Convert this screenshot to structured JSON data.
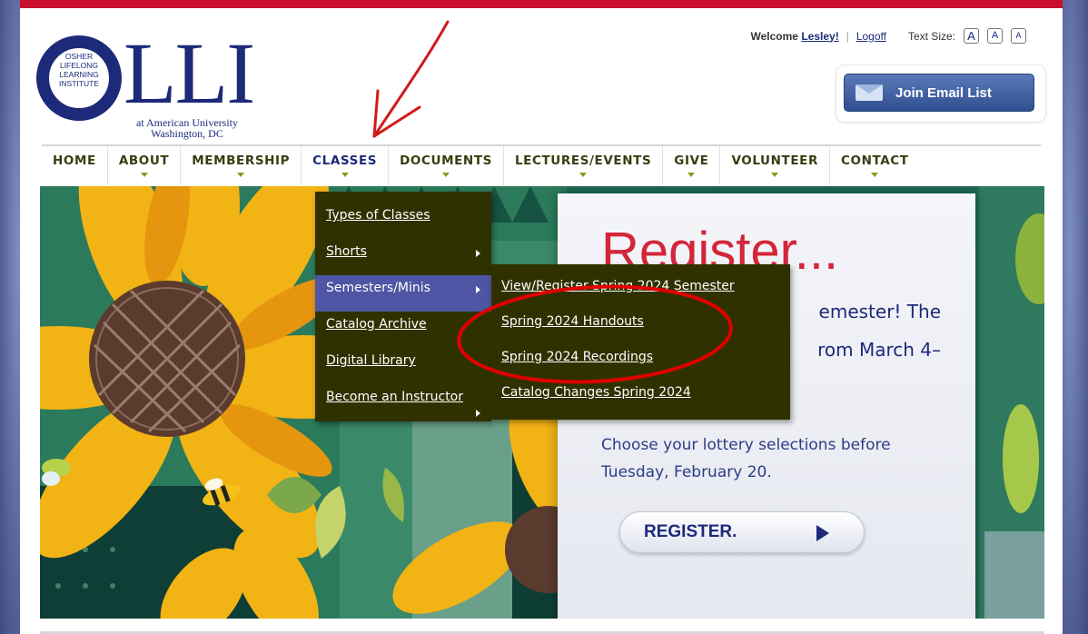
{
  "header": {
    "logo": {
      "o_text_lines": [
        "OSHER",
        "LIFELONG",
        "LEARNING",
        "INSTITUTE"
      ],
      "wordmark": "LLI",
      "subtitle_line1": "at American University",
      "subtitle_line2": "Washington, DC"
    },
    "util": {
      "welcome_prefix": "Welcome",
      "user_name": "Lesley!",
      "logoff": "Logoff",
      "text_size_label": "Text Size:",
      "text_size_large": "A",
      "text_size_medium": "A",
      "text_size_small": "A"
    },
    "email_button": "Join Email List"
  },
  "nav": {
    "items": [
      {
        "label": "HOME"
      },
      {
        "label": "ABOUT"
      },
      {
        "label": "MEMBERSHIP"
      },
      {
        "label": "CLASSES"
      },
      {
        "label": "DOCUMENTS"
      },
      {
        "label": "LECTURES/EVENTS"
      },
      {
        "label": "GIVE"
      },
      {
        "label": "VOLUNTEER"
      },
      {
        "label": "CONTACT"
      }
    ],
    "classes_menu": [
      {
        "label": "Types of Classes"
      },
      {
        "label": "Shorts"
      },
      {
        "label": "Semesters/Minis"
      },
      {
        "label": "Catalog Archive"
      },
      {
        "label": "Digital Library"
      },
      {
        "label": "Become an Instructor"
      }
    ],
    "semesters_submenu": [
      {
        "label": "View/Register Spring 2024 Semester"
      },
      {
        "label": "Spring 2024 Handouts"
      },
      {
        "label": "Spring 2024 Recordings"
      },
      {
        "label": "Catalog Changes Spring 2024"
      }
    ]
  },
  "hero": {
    "title": "Register...",
    "line1": "emester! The",
    "line2": "rom March 4–",
    "choose_text": "Choose your lottery selections before Tuesday, February 20.",
    "button": "REGISTER."
  },
  "colors": {
    "brand_red": "#c8102e",
    "brand_navy": "#1d2a7a",
    "menu_bg": "#2f3200",
    "menu_highlight": "#4d55a4",
    "nav_text": "#3a3d10"
  }
}
